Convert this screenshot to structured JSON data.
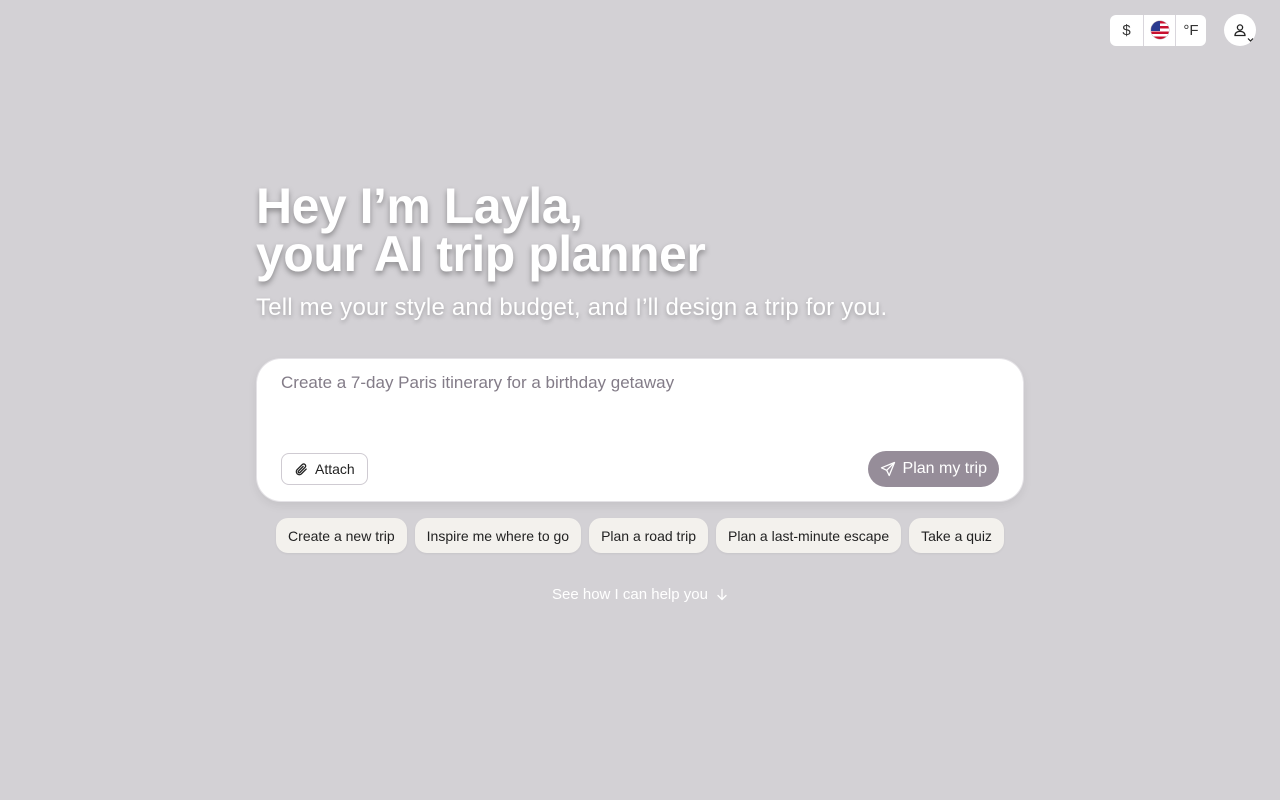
{
  "header": {
    "currency_symbol": "$",
    "region_icon": "us-flag-icon",
    "temperature_unit": "°F",
    "account_icon": "user-icon"
  },
  "hero": {
    "title_line1": "Hey I’m Layla,",
    "title_line2": "your AI trip planner",
    "subtitle": "Tell me your style and budget, and I’ll design a trip for you."
  },
  "composer": {
    "value": "",
    "placeholder": "Create a 7-day Paris itinerary for a birthday getaway",
    "attach_label": "Attach",
    "attach_icon": "paperclip-icon",
    "submit_label": "Plan my trip",
    "submit_icon": "send-icon"
  },
  "suggestions": [
    "Create a new trip",
    "Inspire me where to go",
    "Plan a road trip",
    "Plan a last-minute escape",
    "Take a quiz"
  ],
  "help": {
    "label": "See how I can help you",
    "icon": "arrow-down-icon"
  },
  "colors": {
    "background": "#d3d1d5",
    "submit_button": "#968d99",
    "chip_background": "#f3f1ed"
  }
}
